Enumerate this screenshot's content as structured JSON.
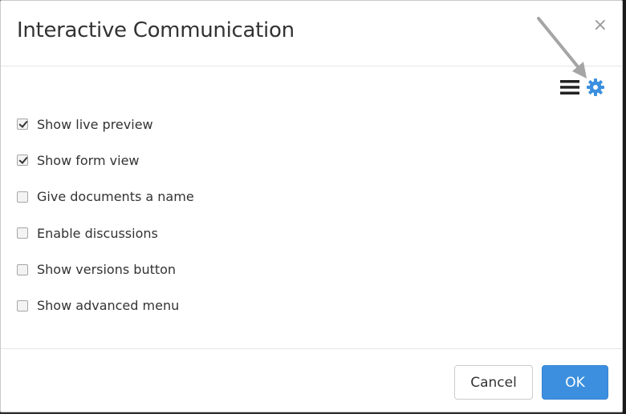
{
  "dialog": {
    "title": "Interactive Communication",
    "close_glyph": "×"
  },
  "toolbar": {
    "menu_icon": "hamburger-menu-icon",
    "settings_icon": "gear-icon",
    "settings_icon_color": "#3c8fde",
    "annotation_arrow_color": "#a5a5a5"
  },
  "options": [
    {
      "label": "Show live preview",
      "checked": true
    },
    {
      "label": "Show form view",
      "checked": true
    },
    {
      "label": "Give documents a name",
      "checked": false
    },
    {
      "label": "Enable discussions",
      "checked": false
    },
    {
      "label": "Show versions button",
      "checked": false
    },
    {
      "label": "Show advanced menu",
      "checked": false
    }
  ],
  "footer": {
    "cancel_label": "Cancel",
    "ok_label": "OK",
    "ok_color": "#3c8fde"
  }
}
